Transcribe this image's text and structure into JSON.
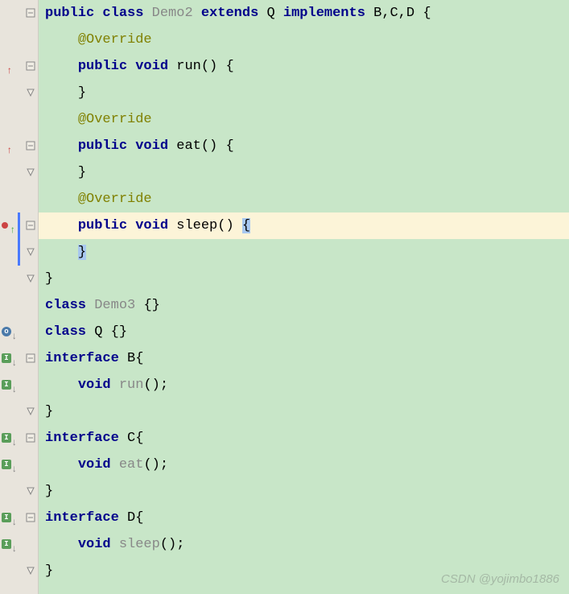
{
  "tokens": {
    "public": "public",
    "class": "class",
    "extends": "extends",
    "implements": "implements",
    "void": "void",
    "interface": "interface"
  },
  "names": {
    "Demo2": "Demo2",
    "Demo3": "Demo3",
    "Q": "Q",
    "B": "B",
    "C": "C",
    "D": "D",
    "BCD": "B,C,D"
  },
  "methods": {
    "run": "run",
    "eat": "eat",
    "sleep": "sleep"
  },
  "annotations": {
    "override": "@Override"
  },
  "symbols": {
    "open_brace": "{",
    "close_brace": "}",
    "empty_braces": "{}",
    "parens": "()",
    "parens_semi": "();",
    "parens_brace": "() {",
    "space": " "
  },
  "watermark": "CSDN @yojimbo1886"
}
